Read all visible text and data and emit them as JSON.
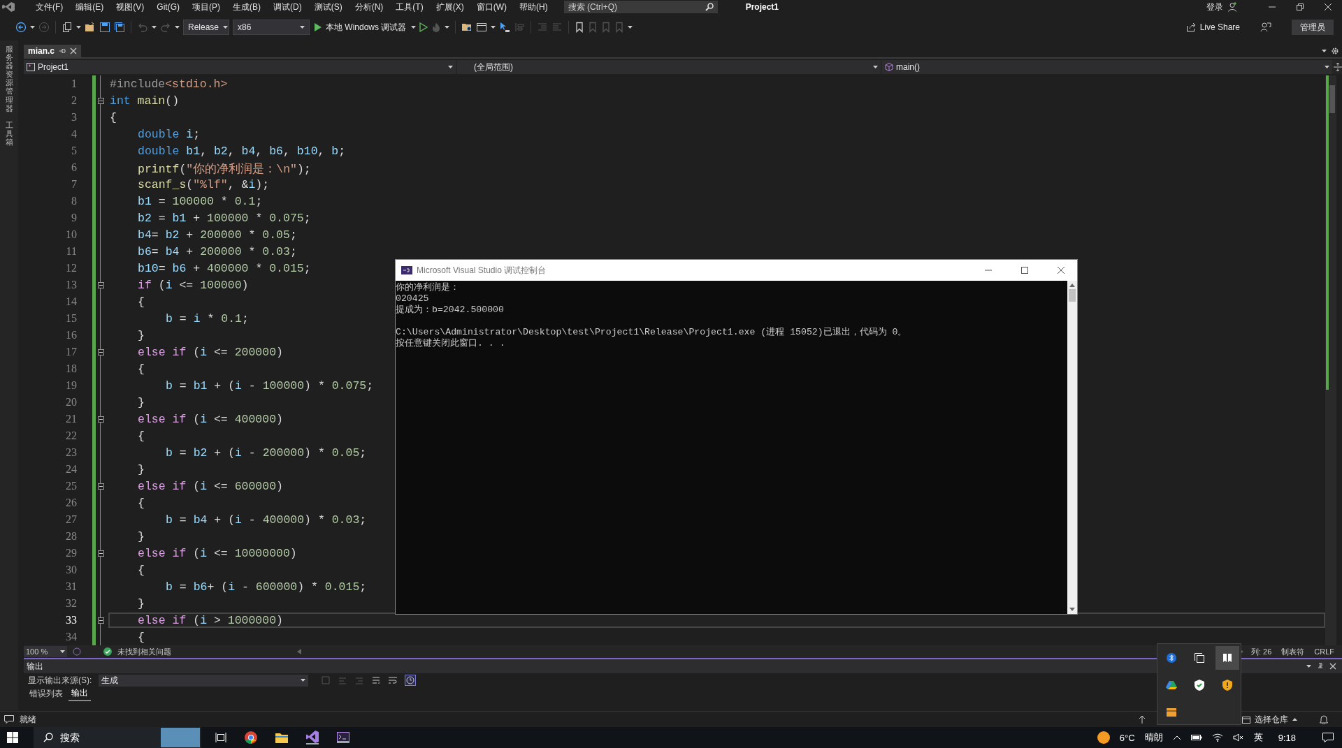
{
  "menu": [
    "文件(F)",
    "编辑(E)",
    "视图(V)",
    "Git(G)",
    "项目(P)",
    "生成(B)",
    "调试(D)",
    "测试(S)",
    "分析(N)",
    "工具(T)",
    "扩展(X)",
    "窗口(W)",
    "帮助(H)"
  ],
  "search": {
    "placeholder": "搜索 (Ctrl+Q)"
  },
  "window": {
    "title": "Project1",
    "sign_in": "登录"
  },
  "toolbar": {
    "configuration": "Release",
    "platform": "x86",
    "debugger": "本地 Windows 调试器",
    "live_share": "Live Share",
    "admin": "管理员"
  },
  "side_strip": [
    "服务器资源管理器",
    "工具箱"
  ],
  "editor_tabs": [
    {
      "label": "mian.c",
      "selected": true
    }
  ],
  "navigation": {
    "project": "Project1",
    "scope": "(全局范围)",
    "member": "main()"
  },
  "code_lines": [
    {
      "number": "1",
      "kind": "top",
      "foldable": false,
      "current": false,
      "tokens": [
        {
          "kind": "pre",
          "text": "#include"
        },
        {
          "kind": "str",
          "text": "<stdio.h>"
        }
      ]
    },
    {
      "number": "2",
      "kind": "top",
      "foldable": true,
      "current": false,
      "tokens": [
        {
          "kind": "type",
          "text": "int"
        },
        {
          "kind": "fn",
          "text": " main"
        },
        {
          "kind": "p",
          "text": "()"
        }
      ]
    },
    {
      "number": "3",
      "kind": "top",
      "foldable": false,
      "current": false,
      "tokens": [
        {
          "kind": "p",
          "text": "{"
        }
      ]
    },
    {
      "number": "4",
      "kind": "body",
      "foldable": false,
      "current": false,
      "tokens": [
        {
          "kind": "type",
          "text": "double"
        },
        {
          "kind": "var",
          "text": " i"
        },
        {
          "kind": "p",
          "text": ";"
        }
      ]
    },
    {
      "number": "5",
      "kind": "body",
      "foldable": false,
      "current": false,
      "tokens": [
        {
          "kind": "type",
          "text": "double"
        },
        {
          "kind": "var",
          "text": " b1"
        },
        {
          "kind": "p",
          "text": ","
        },
        {
          "kind": "var",
          "text": " b2"
        },
        {
          "kind": "p",
          "text": ","
        },
        {
          "kind": "var",
          "text": " b4"
        },
        {
          "kind": "p",
          "text": ","
        },
        {
          "kind": "var",
          "text": " b6"
        },
        {
          "kind": "p",
          "text": ","
        },
        {
          "kind": "var",
          "text": " b10"
        },
        {
          "kind": "p",
          "text": ","
        },
        {
          "kind": "var",
          "text": " b"
        },
        {
          "kind": "p",
          "text": ";"
        }
      ]
    },
    {
      "number": "6",
      "kind": "body",
      "foldable": false,
      "current": false,
      "tokens": [
        {
          "kind": "fn",
          "text": "printf"
        },
        {
          "kind": "p",
          "text": "("
        },
        {
          "kind": "str",
          "text": "\"你的净利润是：\\n\""
        },
        {
          "kind": "p",
          "text": ");"
        }
      ]
    },
    {
      "number": "7",
      "kind": "body",
      "foldable": false,
      "current": false,
      "tokens": [
        {
          "kind": "fn",
          "text": "scanf_s"
        },
        {
          "kind": "p",
          "text": "("
        },
        {
          "kind": "str",
          "text": "\"%lf\""
        },
        {
          "kind": "p",
          "text": ", &"
        },
        {
          "kind": "var",
          "text": "i"
        },
        {
          "kind": "p",
          "text": ");"
        }
      ]
    },
    {
      "number": "8",
      "kind": "body",
      "foldable": false,
      "current": false,
      "tokens": [
        {
          "kind": "var",
          "text": "b1"
        },
        {
          "kind": "p",
          "text": " = "
        },
        {
          "kind": "num",
          "text": "100000"
        },
        {
          "kind": "p",
          "text": " * "
        },
        {
          "kind": "num",
          "text": "0.1"
        },
        {
          "kind": "p",
          "text": ";"
        }
      ]
    },
    {
      "number": "9",
      "kind": "body",
      "foldable": false,
      "current": false,
      "tokens": [
        {
          "kind": "var",
          "text": "b2"
        },
        {
          "kind": "p",
          "text": " = "
        },
        {
          "kind": "var",
          "text": "b1"
        },
        {
          "kind": "p",
          "text": " + "
        },
        {
          "kind": "num",
          "text": "100000"
        },
        {
          "kind": "p",
          "text": " * "
        },
        {
          "kind": "num",
          "text": "0.075"
        },
        {
          "kind": "p",
          "text": ";"
        }
      ]
    },
    {
      "number": "10",
      "kind": "body",
      "foldable": false,
      "current": false,
      "tokens": [
        {
          "kind": "var",
          "text": "b4"
        },
        {
          "kind": "p",
          "text": "= "
        },
        {
          "kind": "var",
          "text": "b2"
        },
        {
          "kind": "p",
          "text": " + "
        },
        {
          "kind": "num",
          "text": "200000"
        },
        {
          "kind": "p",
          "text": " * "
        },
        {
          "kind": "num",
          "text": "0.05"
        },
        {
          "kind": "p",
          "text": ";"
        }
      ]
    },
    {
      "number": "11",
      "kind": "body",
      "foldable": false,
      "current": false,
      "tokens": [
        {
          "kind": "var",
          "text": "b6"
        },
        {
          "kind": "p",
          "text": "= "
        },
        {
          "kind": "var",
          "text": "b4"
        },
        {
          "kind": "p",
          "text": " + "
        },
        {
          "kind": "num",
          "text": "200000"
        },
        {
          "kind": "p",
          "text": " * "
        },
        {
          "kind": "num",
          "text": "0.03"
        },
        {
          "kind": "p",
          "text": ";"
        }
      ]
    },
    {
      "number": "12",
      "kind": "body",
      "foldable": false,
      "current": false,
      "tokens": [
        {
          "kind": "var",
          "text": "b10"
        },
        {
          "kind": "p",
          "text": "= "
        },
        {
          "kind": "var",
          "text": "b6"
        },
        {
          "kind": "p",
          "text": " + "
        },
        {
          "kind": "num",
          "text": "400000"
        },
        {
          "kind": "p",
          "text": " * "
        },
        {
          "kind": "num",
          "text": "0.015"
        },
        {
          "kind": "p",
          "text": ";"
        }
      ]
    },
    {
      "number": "13",
      "kind": "body",
      "foldable": true,
      "current": false,
      "tokens": [
        {
          "kind": "ctl",
          "text": "if"
        },
        {
          "kind": "p",
          "text": " ("
        },
        {
          "kind": "var",
          "text": "i"
        },
        {
          "kind": "p",
          "text": " <= "
        },
        {
          "kind": "num",
          "text": "100000"
        },
        {
          "kind": "p",
          "text": ")"
        }
      ]
    },
    {
      "number": "14",
      "kind": "body",
      "foldable": false,
      "current": false,
      "tokens": [
        {
          "kind": "p",
          "text": "{"
        }
      ]
    },
    {
      "number": "15",
      "kind": "nested",
      "foldable": false,
      "current": false,
      "tokens": [
        {
          "kind": "var",
          "text": "b"
        },
        {
          "kind": "p",
          "text": " = "
        },
        {
          "kind": "var",
          "text": "i"
        },
        {
          "kind": "p",
          "text": " * "
        },
        {
          "kind": "num",
          "text": "0.1"
        },
        {
          "kind": "p",
          "text": ";"
        }
      ]
    },
    {
      "number": "16",
      "kind": "body",
      "foldable": false,
      "current": false,
      "tokens": [
        {
          "kind": "p",
          "text": "}"
        }
      ]
    },
    {
      "number": "17",
      "kind": "body",
      "foldable": true,
      "current": false,
      "tokens": [
        {
          "kind": "ctl",
          "text": "else if"
        },
        {
          "kind": "p",
          "text": " ("
        },
        {
          "kind": "var",
          "text": "i"
        },
        {
          "kind": "p",
          "text": " <= "
        },
        {
          "kind": "num",
          "text": "200000"
        },
        {
          "kind": "p",
          "text": ")"
        }
      ]
    },
    {
      "number": "18",
      "kind": "body",
      "foldable": false,
      "current": false,
      "tokens": [
        {
          "kind": "p",
          "text": "{"
        }
      ]
    },
    {
      "number": "19",
      "kind": "nested",
      "foldable": false,
      "current": false,
      "tokens": [
        {
          "kind": "var",
          "text": "b"
        },
        {
          "kind": "p",
          "text": " = "
        },
        {
          "kind": "var",
          "text": "b1"
        },
        {
          "kind": "p",
          "text": " + ("
        },
        {
          "kind": "var",
          "text": "i"
        },
        {
          "kind": "p",
          "text": " - "
        },
        {
          "kind": "num",
          "text": "100000"
        },
        {
          "kind": "p",
          "text": ") * "
        },
        {
          "kind": "num",
          "text": "0.075"
        },
        {
          "kind": "p",
          "text": ";"
        }
      ]
    },
    {
      "number": "20",
      "kind": "body",
      "foldable": false,
      "current": false,
      "tokens": [
        {
          "kind": "p",
          "text": "}"
        }
      ]
    },
    {
      "number": "21",
      "kind": "body",
      "foldable": true,
      "current": false,
      "tokens": [
        {
          "kind": "ctl",
          "text": "else if"
        },
        {
          "kind": "p",
          "text": " ("
        },
        {
          "kind": "var",
          "text": "i"
        },
        {
          "kind": "p",
          "text": " <= "
        },
        {
          "kind": "num",
          "text": "400000"
        },
        {
          "kind": "p",
          "text": ")"
        }
      ]
    },
    {
      "number": "22",
      "kind": "body",
      "foldable": false,
      "current": false,
      "tokens": [
        {
          "kind": "p",
          "text": "{"
        }
      ]
    },
    {
      "number": "23",
      "kind": "nested",
      "foldable": false,
      "current": false,
      "tokens": [
        {
          "kind": "var",
          "text": "b"
        },
        {
          "kind": "p",
          "text": " = "
        },
        {
          "kind": "var",
          "text": "b2"
        },
        {
          "kind": "p",
          "text": " + ("
        },
        {
          "kind": "var",
          "text": "i"
        },
        {
          "kind": "p",
          "text": " - "
        },
        {
          "kind": "num",
          "text": "200000"
        },
        {
          "kind": "p",
          "text": ") * "
        },
        {
          "kind": "num",
          "text": "0.05"
        },
        {
          "kind": "p",
          "text": ";"
        }
      ]
    },
    {
      "number": "24",
      "kind": "body",
      "foldable": false,
      "current": false,
      "tokens": [
        {
          "kind": "p",
          "text": "}"
        }
      ]
    },
    {
      "number": "25",
      "kind": "body",
      "foldable": true,
      "current": false,
      "tokens": [
        {
          "kind": "ctl",
          "text": "else if"
        },
        {
          "kind": "p",
          "text": " ("
        },
        {
          "kind": "var",
          "text": "i"
        },
        {
          "kind": "p",
          "text": " <= "
        },
        {
          "kind": "num",
          "text": "600000"
        },
        {
          "kind": "p",
          "text": ")"
        }
      ]
    },
    {
      "number": "26",
      "kind": "body",
      "foldable": false,
      "current": false,
      "tokens": [
        {
          "kind": "p",
          "text": "{"
        }
      ]
    },
    {
      "number": "27",
      "kind": "nested",
      "foldable": false,
      "current": false,
      "tokens": [
        {
          "kind": "var",
          "text": "b"
        },
        {
          "kind": "p",
          "text": " = "
        },
        {
          "kind": "var",
          "text": "b4"
        },
        {
          "kind": "p",
          "text": " + ("
        },
        {
          "kind": "var",
          "text": "i"
        },
        {
          "kind": "p",
          "text": " - "
        },
        {
          "kind": "num",
          "text": "400000"
        },
        {
          "kind": "p",
          "text": ") * "
        },
        {
          "kind": "num",
          "text": "0.03"
        },
        {
          "kind": "p",
          "text": ";"
        }
      ]
    },
    {
      "number": "28",
      "kind": "body",
      "foldable": false,
      "current": false,
      "tokens": [
        {
          "kind": "p",
          "text": "}"
        }
      ]
    },
    {
      "number": "29",
      "kind": "body",
      "foldable": true,
      "current": false,
      "tokens": [
        {
          "kind": "ctl",
          "text": "else if"
        },
        {
          "kind": "p",
          "text": " ("
        },
        {
          "kind": "var",
          "text": "i"
        },
        {
          "kind": "p",
          "text": " <= "
        },
        {
          "kind": "num",
          "text": "10000000"
        },
        {
          "kind": "p",
          "text": ")"
        }
      ]
    },
    {
      "number": "30",
      "kind": "body",
      "foldable": false,
      "current": false,
      "tokens": [
        {
          "kind": "p",
          "text": "{"
        }
      ]
    },
    {
      "number": "31",
      "kind": "nested",
      "foldable": false,
      "current": false,
      "tokens": [
        {
          "kind": "var",
          "text": "b"
        },
        {
          "kind": "p",
          "text": " = "
        },
        {
          "kind": "var",
          "text": "b6"
        },
        {
          "kind": "p",
          "text": "+ ("
        },
        {
          "kind": "var",
          "text": "i"
        },
        {
          "kind": "p",
          "text": " - "
        },
        {
          "kind": "num",
          "text": "600000"
        },
        {
          "kind": "p",
          "text": ") * "
        },
        {
          "kind": "num",
          "text": "0.015"
        },
        {
          "kind": "p",
          "text": ";"
        }
      ]
    },
    {
      "number": "32",
      "kind": "body",
      "foldable": false,
      "current": false,
      "tokens": [
        {
          "kind": "p",
          "text": "}"
        }
      ]
    },
    {
      "number": "33",
      "kind": "body",
      "foldable": true,
      "current": true,
      "tokens": [
        {
          "kind": "ctl",
          "text": "else if"
        },
        {
          "kind": "p",
          "text": " ("
        },
        {
          "kind": "var",
          "text": "i"
        },
        {
          "kind": "p",
          "text": " > "
        },
        {
          "kind": "num",
          "text": "1000000"
        },
        {
          "kind": "p",
          "text": ")"
        }
      ]
    },
    {
      "number": "34",
      "kind": "body",
      "foldable": false,
      "current": false,
      "tokens": [
        {
          "kind": "p",
          "text": "{"
        }
      ]
    }
  ],
  "editor_status": {
    "zoom": "100 %",
    "issues": "未找到相关问题",
    "column": "列: 26",
    "indent": "制表符",
    "line_ending": "CRLF"
  },
  "output_panel": {
    "title": "输出",
    "source_label": "显示输出来源(S):",
    "source": "生成",
    "tabs": [
      {
        "label": "错误列表",
        "selected": false
      },
      {
        "label": "输出",
        "selected": true
      }
    ]
  },
  "status_bar": {
    "text": "就绪",
    "repository": "选择仓库"
  },
  "console": {
    "title": "Microsoft Visual Studio 调试控制台",
    "lines": [
      {
        "text": "你的净利润是：",
        "blank_before": false
      },
      {
        "text": "020425",
        "blank_before": false
      },
      {
        "text": "提成为：b=2042.500000",
        "blank_before": false
      },
      {
        "text": "C:\\Users\\Administrator\\Desktop\\test\\Project1\\Release\\Project1.exe (进程 15052)已退出，代码为 0。",
        "blank_before": true
      },
      {
        "text": "按任意键关闭此窗口. . .",
        "blank_before": false
      }
    ]
  },
  "taskbar": {
    "search_placeholder": "搜索",
    "temperature": "6°C",
    "condition": "晴朗",
    "language": "英",
    "time": "9:18"
  }
}
